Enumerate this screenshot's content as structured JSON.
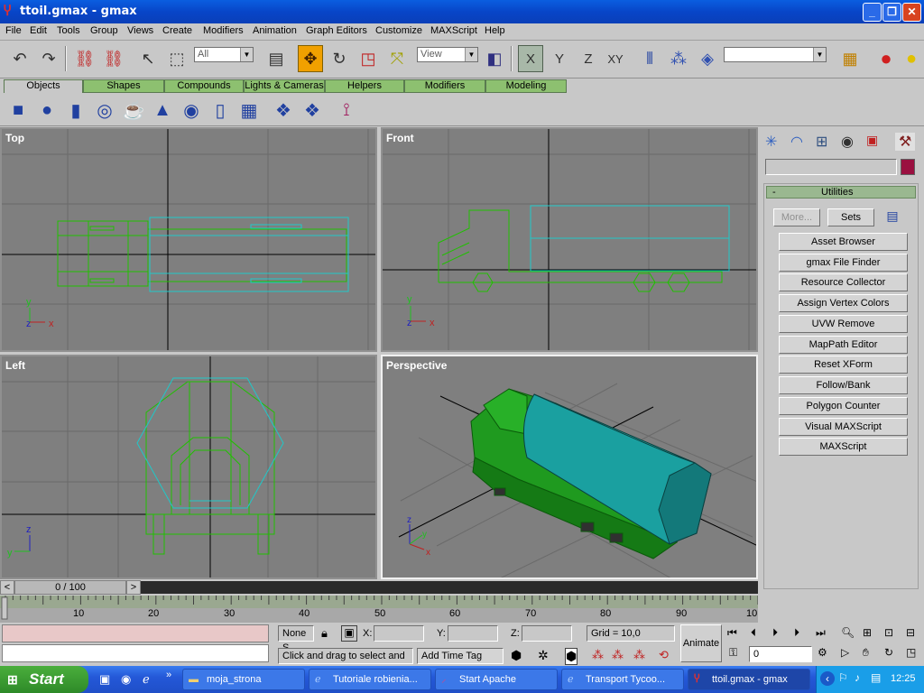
{
  "window": {
    "title": "ttoil.gmax - gmax",
    "minimize": "_",
    "restore": "❐",
    "close": "✕"
  },
  "menu": [
    "File",
    "Edit",
    "Tools",
    "Group",
    "Views",
    "Create",
    "Modifiers",
    "Animation",
    "Graph Editors",
    "Customize",
    "MAXScript",
    "Help"
  ],
  "toolbar": {
    "selection_filter": "All",
    "ref_coord": "View",
    "axis_x": "X",
    "axis_y": "Y",
    "axis_z": "Z",
    "axis_xy": "XY",
    "named_selection": ""
  },
  "tabs": [
    "Objects",
    "Shapes",
    "Compounds",
    "Lights & Cameras",
    "Helpers",
    "Modifiers",
    "Modeling"
  ],
  "viewports": {
    "top": "Top",
    "front": "Front",
    "left": "Left",
    "perspective": "Perspective"
  },
  "axes": {
    "x": "x",
    "y": "y",
    "z": "z"
  },
  "command_panel": {
    "rollout_minus": "-",
    "rollout_title": "Utilities",
    "more_button": "More...",
    "sets_button": "Sets",
    "utilities": [
      "Asset Browser",
      "gmax File Finder",
      "Resource Collector",
      "Assign Vertex Colors",
      "UVW Remove",
      "MapPath Editor",
      "Reset XForm",
      "Follow/Bank",
      "Polygon Counter",
      "Visual MAXScript",
      "MAXScript"
    ],
    "name_field": "",
    "color_swatch": "#9a1040"
  },
  "timeline": {
    "slider_label": "0 / 100",
    "prev": "<",
    "next": ">",
    "ticks": [
      "10",
      "20",
      "30",
      "40",
      "50",
      "60",
      "70",
      "80",
      "90",
      "10"
    ]
  },
  "status": {
    "selection": "None S",
    "x_label": "X:",
    "y_label": "Y:",
    "z_label": "Z:",
    "x_value": "",
    "y_value": "",
    "z_value": "",
    "grid": "Grid = 10,0",
    "prompt": "Click and drag to select and m",
    "add_time_tag": "Add Time Tag",
    "animate": "Animate",
    "frame": "0"
  },
  "taskbar": {
    "start": "Start",
    "tasks": [
      "moja_strona",
      "Tutoriale robienia...",
      "Start Apache",
      "Transport Tycoo...",
      "ttoil.gmax - gmax"
    ],
    "clock": "12:25"
  }
}
